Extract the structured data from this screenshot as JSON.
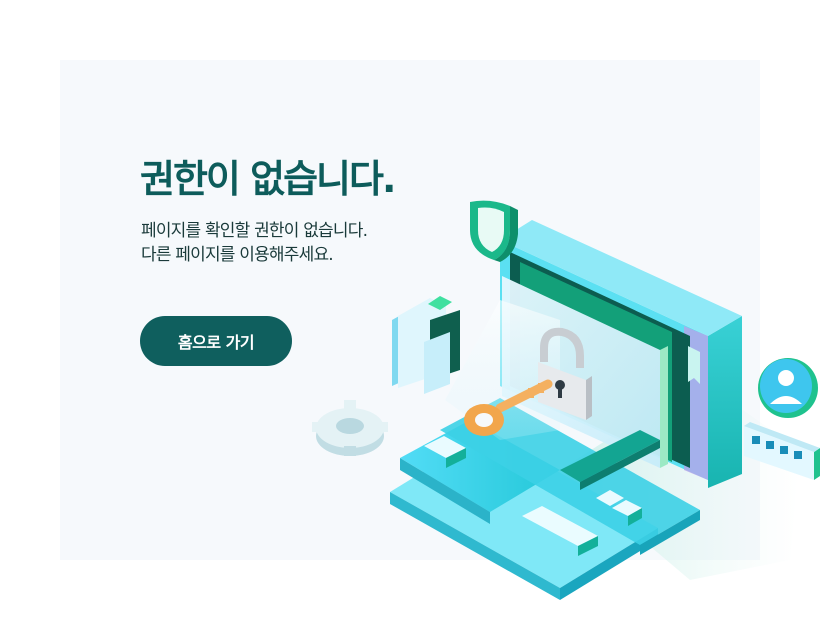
{
  "page": {
    "title": "권한이 없습니다.",
    "description_lines": [
      "페이지를 확인할 권한이 없습니다.",
      "다른 페이지를 이용해주세요."
    ],
    "home_button_label": "홈으로 가기"
  },
  "colors": {
    "brand_dark": "#0d5c5b",
    "button_bg": "#0f5f5e",
    "panel_bg": "#f6f9fc",
    "teal": "#2ec5b9",
    "cyan": "#3fc6ea",
    "key_orange": "#f4b060"
  },
  "illustration": {
    "icons": [
      "computer-monitor",
      "padlock-icon",
      "key-icon",
      "gear-icon",
      "shield-icon",
      "folder-icon",
      "user-icon",
      "password-field"
    ]
  }
}
